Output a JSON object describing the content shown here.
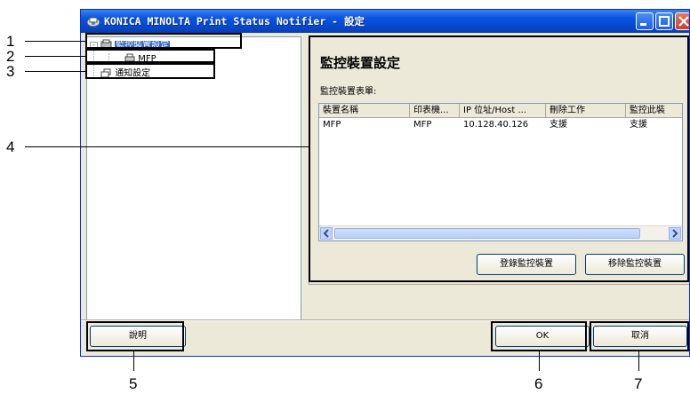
{
  "window": {
    "title": "KONICA MINOLTA Print Status Notifier - 設定"
  },
  "tree": {
    "items": [
      {
        "label": "監控裝置設定",
        "selected": true,
        "icon": "monitor-device-icon"
      },
      {
        "label": "MFP",
        "icon": "printer-icon"
      },
      {
        "label": "通知設定",
        "icon": "notification-icon"
      }
    ]
  },
  "panel": {
    "title": "監控裝置設定",
    "list_label": "監控裝置表單:",
    "columns": [
      "裝置名稱",
      "印表機...",
      "IP 位址/Host ...",
      "刪除工作",
      "監控此裝"
    ],
    "rows": [
      [
        "MFP",
        "MFP",
        "10.128.40.126",
        "支援",
        "支援"
      ]
    ],
    "register_button": "登錄監控裝置",
    "remove_button": "移除監控裝置"
  },
  "footer": {
    "help_button": "說明",
    "ok_button": "OK",
    "cancel_button": "取消"
  },
  "callouts": [
    "1",
    "2",
    "3",
    "4",
    "5",
    "6",
    "7"
  ]
}
